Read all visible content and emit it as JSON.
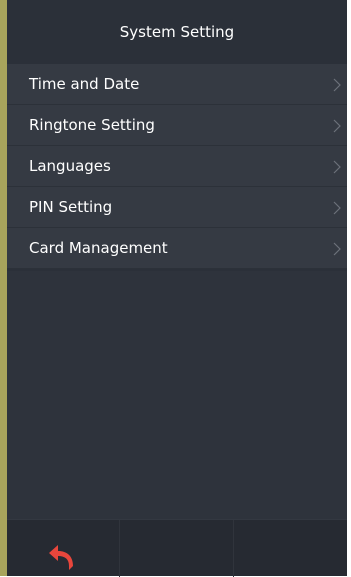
{
  "header": {
    "title": "System Setting"
  },
  "menu": {
    "items": [
      {
        "label": "Time and Date"
      },
      {
        "label": "Ringtone Setting"
      },
      {
        "label": "Languages"
      },
      {
        "label": "PIN Setting"
      },
      {
        "label": "Card Management"
      }
    ]
  },
  "icons": {
    "chevron": "chevron-right-icon",
    "back": "back-arrow-icon"
  },
  "colors": {
    "screen_bg": "#2b3039",
    "item_bg": "#353a43",
    "bottom_bar_bg": "#262a32",
    "back_icon": "#e8463c",
    "bezel": "#a8a45c"
  }
}
